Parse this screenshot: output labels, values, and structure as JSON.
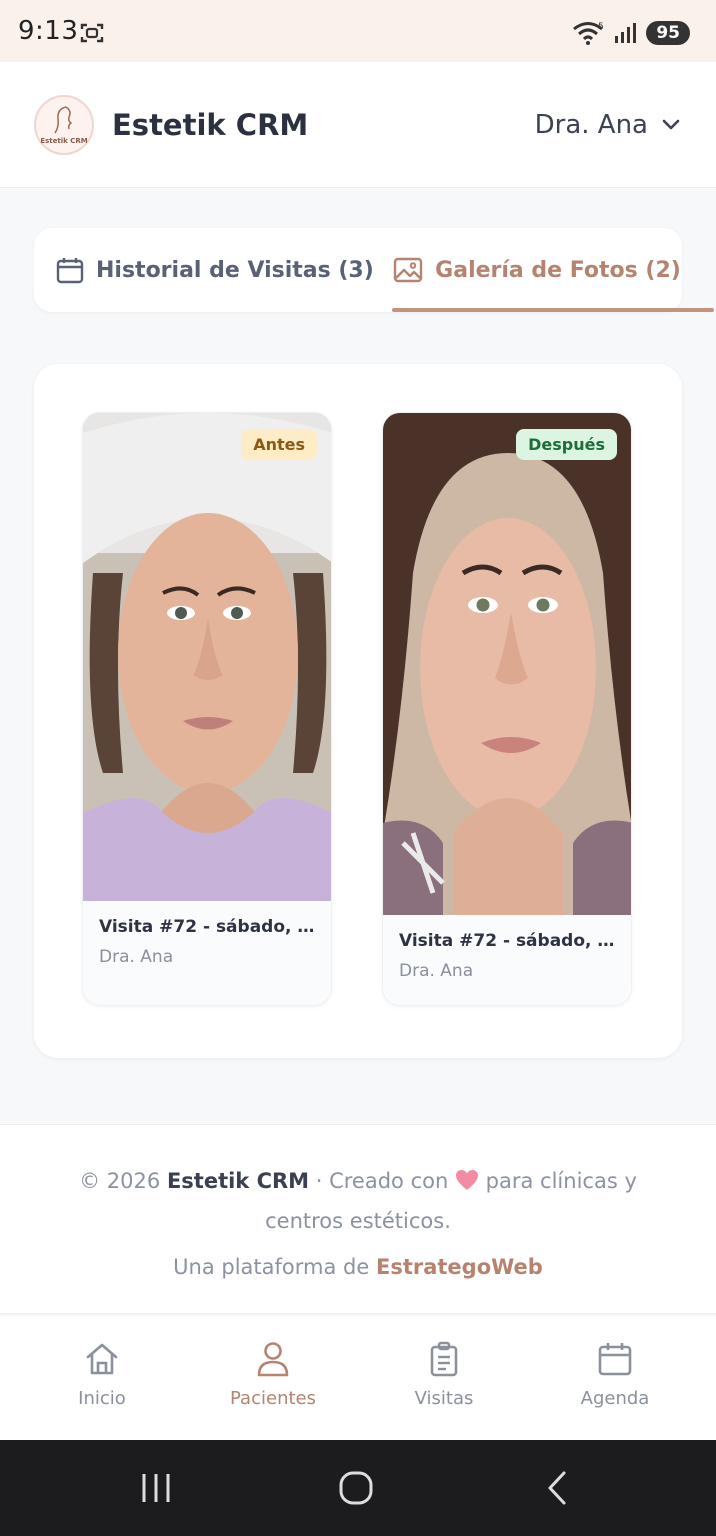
{
  "status_bar": {
    "time": "9:13",
    "battery": "95",
    "signal_sup": "5"
  },
  "header": {
    "app_title": "Estetik CRM",
    "logo_text": "Estetik CRM",
    "user_name": "Dra. Ana"
  },
  "tabs": [
    {
      "label": "Historial de Visitas (3)",
      "icon": "calendar-icon",
      "active": false
    },
    {
      "label": "Galería de Fotos (2)",
      "icon": "image-icon",
      "active": true
    }
  ],
  "photos": [
    {
      "badge": "Antes",
      "visit": "Visita #72 - sábado, 1...",
      "doctor": "Dra. Ana",
      "badge_color": "#fdecc5"
    },
    {
      "badge": "Después",
      "visit": "Visita #72 - sábado, 1...",
      "doctor": "Dra. Ana",
      "badge_color": "#dcf5e2"
    }
  ],
  "footer": {
    "copyright": "© 2026",
    "brand": "Estetik CRM",
    "created_with": "· Creado con",
    "tagline": "para clínicas y centros estéticos.",
    "platform_prefix": "Una plataforma de",
    "platform_link": "EstrategoWeb"
  },
  "bottom_nav": [
    {
      "label": "Inicio",
      "icon": "home-icon",
      "active": false
    },
    {
      "label": "Pacientes",
      "icon": "user-icon",
      "active": true
    },
    {
      "label": "Visitas",
      "icon": "clipboard-icon",
      "active": false
    },
    {
      "label": "Agenda",
      "icon": "calendar-icon",
      "active": false
    }
  ],
  "colors": {
    "accent": "#b5836f",
    "text": "#2b3140",
    "muted": "#8a909c"
  }
}
